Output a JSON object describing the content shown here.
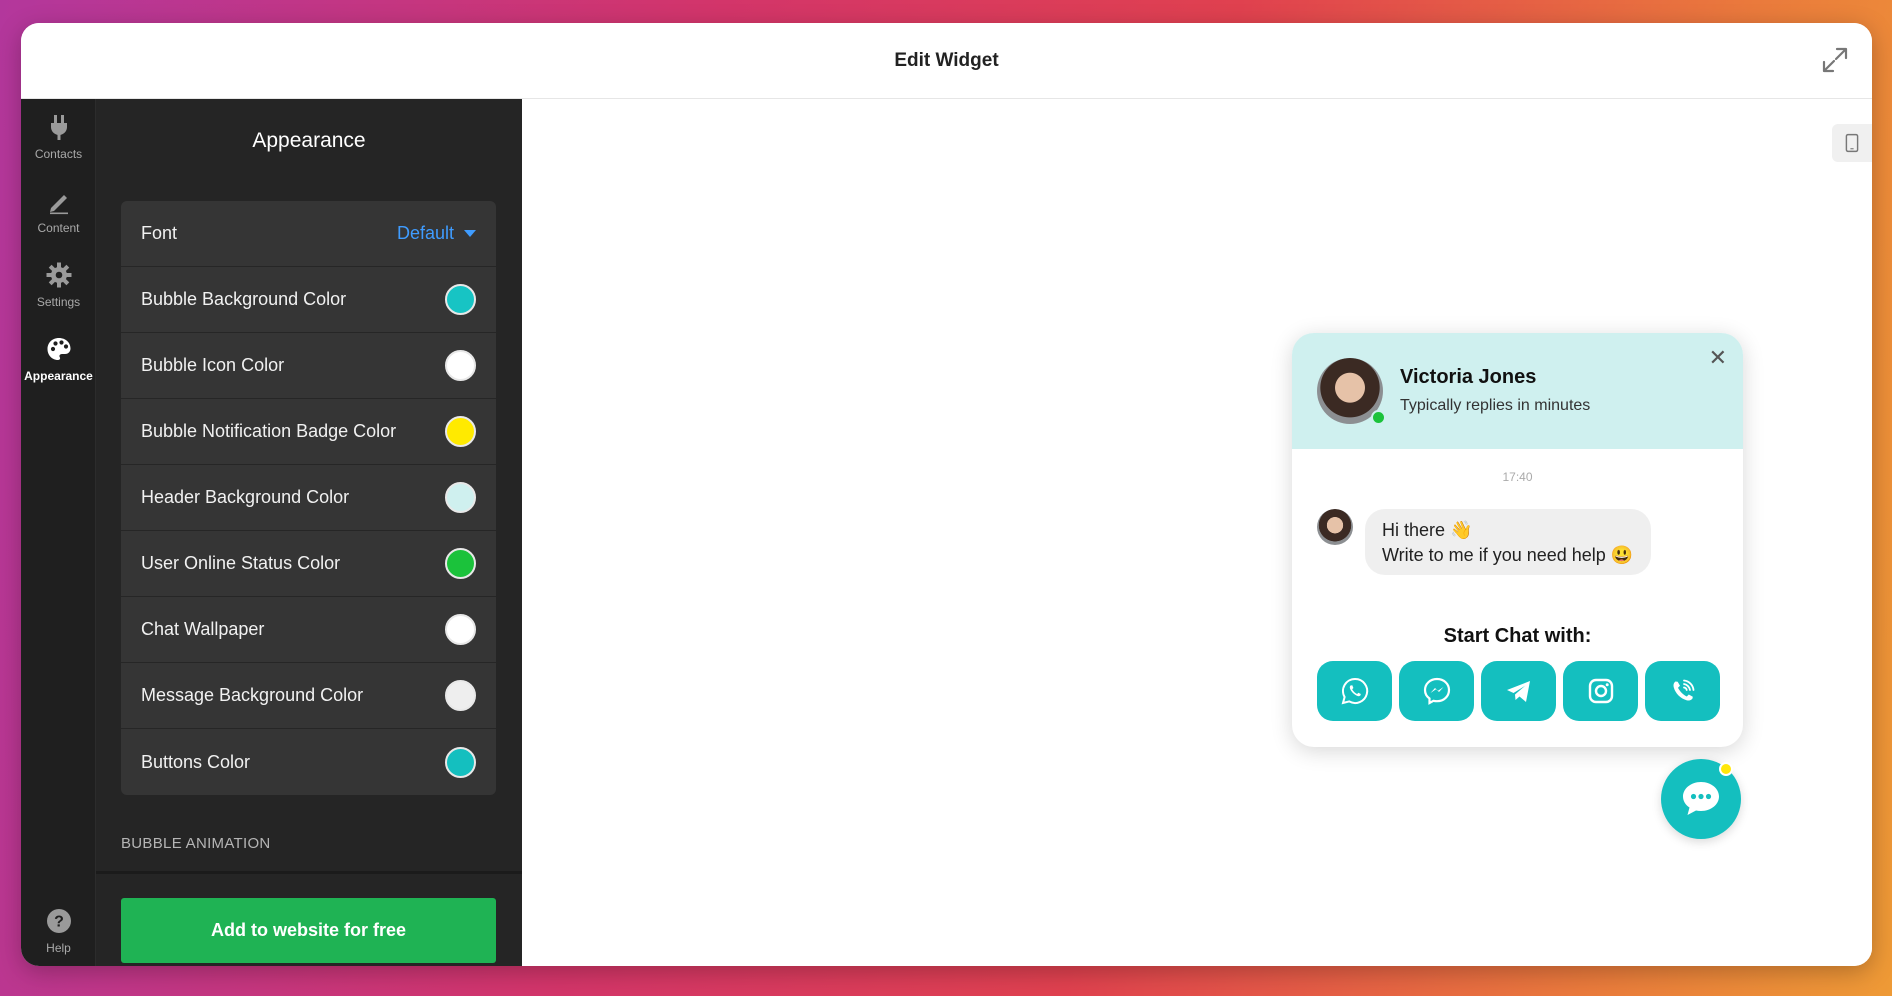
{
  "window": {
    "title": "Edit Widget"
  },
  "nav": {
    "items": [
      {
        "label": "Contacts",
        "icon": "plug-icon",
        "active": false
      },
      {
        "label": "Content",
        "icon": "pencil-icon",
        "active": false
      },
      {
        "label": "Settings",
        "icon": "gear-icon",
        "active": false
      },
      {
        "label": "Appearance",
        "icon": "palette-icon",
        "active": true
      }
    ],
    "help_label": "Help"
  },
  "panel": {
    "title": "Appearance",
    "font": {
      "label": "Font",
      "value": "Default"
    },
    "colors": [
      {
        "label": "Bubble Background Color",
        "color": "#17c4c4"
      },
      {
        "label": "Bubble Icon Color",
        "color": "#ffffff"
      },
      {
        "label": "Bubble Notification Badge Color",
        "color": "#ffea00"
      },
      {
        "label": "Header Background Color",
        "color": "#cff0ef"
      },
      {
        "label": "User Online Status Color",
        "color": "#1bc23b"
      },
      {
        "label": "Chat Wallpaper",
        "color": "#ffffff"
      },
      {
        "label": "Message Background Color",
        "color": "#eeeeee"
      },
      {
        "label": "Buttons Color",
        "color": "#14bfbf"
      }
    ],
    "section_label": "BUBBLE ANIMATION",
    "cta_label": "Add to website for free"
  },
  "preview": {
    "agent_name": "Victoria Jones",
    "agent_status": "Typically replies in minutes",
    "timestamp": "17:40",
    "message_line1": "Hi there 👋",
    "message_line2": "Write to me if you need help 😃",
    "start_chat_label": "Start Chat with:",
    "channels": [
      "whatsapp-icon",
      "messenger-icon",
      "telegram-icon",
      "instagram-icon",
      "viber-icon"
    ],
    "accent_color": "#14bfbf",
    "badge_color": "#ffe70a"
  }
}
